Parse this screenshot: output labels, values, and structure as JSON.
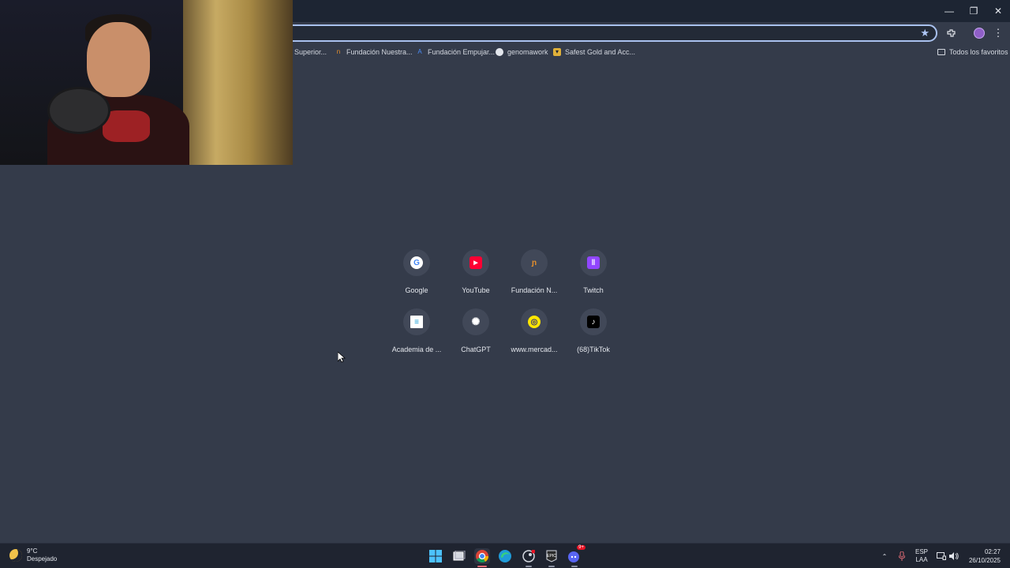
{
  "window": {
    "minimize_glyph": "—",
    "maximize_glyph": "❐",
    "close_glyph": "✕"
  },
  "bookmarks": [
    {
      "label": "Superior...",
      "icon": "bookmark-icon"
    },
    {
      "label": "Fundación Nuestra...",
      "icon": "fundacion-nuestra-icon"
    },
    {
      "label": "Fundación Empujar...",
      "icon": "fundacion-empujar-icon"
    },
    {
      "label": "genomawork",
      "icon": "genomawork-icon"
    },
    {
      "label": "Safest Gold and Acc...",
      "icon": "safest-gold-icon"
    }
  ],
  "all_bookmarks_label": "Todos los favoritos",
  "shortcuts": [
    {
      "label": "Google",
      "icon": "google-icon",
      "glyph": "G",
      "color": "#ffffff",
      "fg": "#4285f4"
    },
    {
      "label": "YouTube",
      "icon": "youtube-icon",
      "glyph": "▶",
      "color": "#ff0033",
      "fg": "#ffffff"
    },
    {
      "label": "Fundación N...",
      "icon": "fundacion-icon",
      "glyph": "n",
      "color": "#414858",
      "fg": "#e8902c"
    },
    {
      "label": "Twitch",
      "icon": "twitch-icon",
      "glyph": "t",
      "color": "#9146ff",
      "fg": "#ffffff"
    },
    {
      "label": "Academia de ...",
      "icon": "cisco-icon",
      "glyph": "≡",
      "color": "#ffffff",
      "fg": "#1ba0d7"
    },
    {
      "label": "ChatGPT",
      "icon": "chatgpt-icon",
      "glyph": "✺",
      "color": "#414858",
      "fg": "#ffffff"
    },
    {
      "label": "www.mercad...",
      "icon": "mercadolibre-icon",
      "glyph": "◎",
      "color": "#ffe600",
      "fg": "#2d3277"
    },
    {
      "label": "(68)TikTok",
      "icon": "tiktok-icon",
      "glyph": "♪",
      "color": "#000000",
      "fg": "#ffffff"
    }
  ],
  "taskbar": {
    "temperature": "9°C",
    "weather": "Despejado",
    "lang_top": "ESP",
    "lang_bottom": "LAA",
    "time": "02:27",
    "date": "26/10/2025",
    "discord_badge": "9+"
  }
}
